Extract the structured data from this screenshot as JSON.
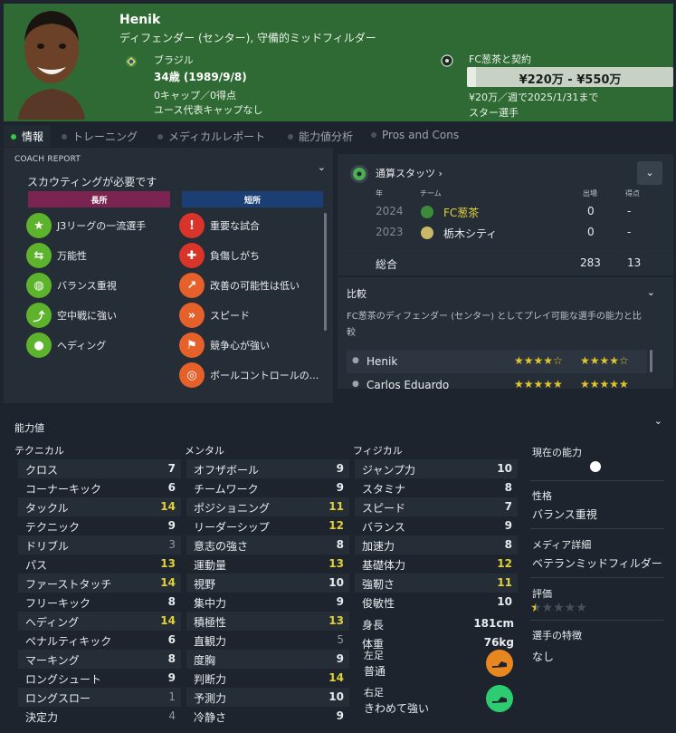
{
  "header": {
    "player_name": "Henik",
    "position": "ディフェンダー (センター), 守備的ミッドフィルダー",
    "nationality": "ブラジル",
    "age": "34歳 (1989/9/8)",
    "caps": "0キャップ／0得点",
    "youth_caps": "ユース代表キャップなし",
    "contract_title": "FC葱茶と契約",
    "value_range": "¥220万 - ¥550万",
    "wage": "¥20万／週で2025/1/31まで",
    "status": "スター選手"
  },
  "tabs": [
    {
      "label": "情報",
      "active": true
    },
    {
      "label": "トレーニング",
      "active": false
    },
    {
      "label": "メディカルレポート",
      "active": false
    },
    {
      "label": "能力値分析",
      "active": false
    },
    {
      "label": "Pros and Cons",
      "active": false
    }
  ],
  "coach_report": {
    "label": "COACH REPORT",
    "scouting_needed": "スカウティングが必要です",
    "strengths_label": "長所",
    "weaknesses_label": "短所",
    "strengths": [
      {
        "text": "J3リーグの一流選手",
        "icon": "star-icon"
      },
      {
        "text": "万能性",
        "icon": "versatility-icon"
      },
      {
        "text": "バランス重視",
        "icon": "brain-icon"
      },
      {
        "text": "空中戦に強い",
        "icon": "aerial-icon"
      },
      {
        "text": "ヘディング",
        "icon": "heading-icon"
      }
    ],
    "weaknesses": [
      {
        "text": "重要な試合",
        "icon": "big-match-icon"
      },
      {
        "text": "負傷しがち",
        "icon": "medical-cross-icon"
      },
      {
        "text": "改善の可能性は低い",
        "icon": "trend-icon"
      },
      {
        "text": "スピード",
        "icon": "boot-speed-icon"
      },
      {
        "text": "競争心が強い",
        "icon": "competitive-icon"
      },
      {
        "text": "ボールコントロールの...",
        "icon": "ball-control-icon"
      }
    ]
  },
  "career_stats": {
    "title": "通算スタッツ",
    "headers": {
      "year": "年",
      "team": "チーム",
      "apps": "出場",
      "goals": "得点"
    },
    "rows": [
      {
        "year": "2024",
        "team": "FC葱茶",
        "apps": "0",
        "goals": "-"
      },
      {
        "year": "2023",
        "team": "栃木シティ",
        "apps": "0",
        "goals": "-"
      }
    ],
    "total_label": "総合",
    "total_apps": "283",
    "total_goals": "13"
  },
  "comparison": {
    "title": "比較",
    "description": "FC葱茶のディフェンダー (センター) としてプレイ可能な選手の能力と比較",
    "players": [
      {
        "name": "Henik",
        "stars_current": 4.5,
        "stars_potential": 4.5
      },
      {
        "name": "Carlos Eduardo",
        "stars_current": 5,
        "stars_potential": 5
      }
    ]
  },
  "attributes": {
    "title": "能力値",
    "technical_label": "テクニカル",
    "mental_label": "メンタル",
    "physical_label": "フィジカル",
    "technical": [
      {
        "name": "クロス",
        "value": "7"
      },
      {
        "name": "コーナーキック",
        "value": "6"
      },
      {
        "name": "タックル",
        "value": "14"
      },
      {
        "name": "テクニック",
        "value": "9"
      },
      {
        "name": "ドリブル",
        "value": "3"
      },
      {
        "name": "パス",
        "value": "13"
      },
      {
        "name": "ファーストタッチ",
        "value": "14"
      },
      {
        "name": "フリーキック",
        "value": "8"
      },
      {
        "name": "ヘディング",
        "value": "14"
      },
      {
        "name": "ペナルティキック",
        "value": "6"
      },
      {
        "name": "マーキング",
        "value": "8"
      },
      {
        "name": "ロングシュート",
        "value": "9"
      },
      {
        "name": "ロングスロー",
        "value": "1"
      },
      {
        "name": "決定力",
        "value": "4"
      }
    ],
    "mental": [
      {
        "name": "オフザボール",
        "value": "9"
      },
      {
        "name": "チームワーク",
        "value": "9"
      },
      {
        "name": "ポジショニング",
        "value": "11"
      },
      {
        "name": "リーダーシップ",
        "value": "12"
      },
      {
        "name": "意志の強さ",
        "value": "8"
      },
      {
        "name": "運動量",
        "value": "13"
      },
      {
        "name": "視野",
        "value": "10"
      },
      {
        "name": "集中力",
        "value": "9"
      },
      {
        "name": "積極性",
        "value": "13"
      },
      {
        "name": "直観力",
        "value": "5"
      },
      {
        "name": "度胸",
        "value": "9"
      },
      {
        "name": "判断力",
        "value": "14"
      },
      {
        "name": "予測力",
        "value": "10"
      },
      {
        "name": "冷静さ",
        "value": "9"
      }
    ],
    "physical": [
      {
        "name": "ジャンプ力",
        "value": "10"
      },
      {
        "name": "スタミナ",
        "value": "8"
      },
      {
        "name": "スピード",
        "value": "7"
      },
      {
        "name": "バランス",
        "value": "9"
      },
      {
        "name": "加速力",
        "value": "8"
      },
      {
        "name": "基礎体力",
        "value": "12"
      },
      {
        "name": "強靭さ",
        "value": "11"
      },
      {
        "name": "俊敏性",
        "value": "10"
      }
    ],
    "height_label": "身長",
    "height": "181cm",
    "weight_label": "体重",
    "weight": "76kg",
    "left_foot_label": "左足",
    "left_foot": "普通",
    "right_foot_label": "右足",
    "right_foot": "きわめて強い"
  },
  "side_info": {
    "current_ability_label": "現在の能力",
    "personality_label": "性格",
    "personality": "バランス重視",
    "media_label": "メディア詳細",
    "media": "ベテランミッドフィルダー",
    "rating_label": "評価",
    "rating": 0.5,
    "traits_label": "選手の特徴",
    "traits": "なし"
  },
  "colors": {
    "header_bg": "#2f6a34",
    "strength_header": "#7c2451",
    "weakness_header": "#1b3f74",
    "highlight_value": "#e2d23a",
    "star": "#e2c52a"
  }
}
